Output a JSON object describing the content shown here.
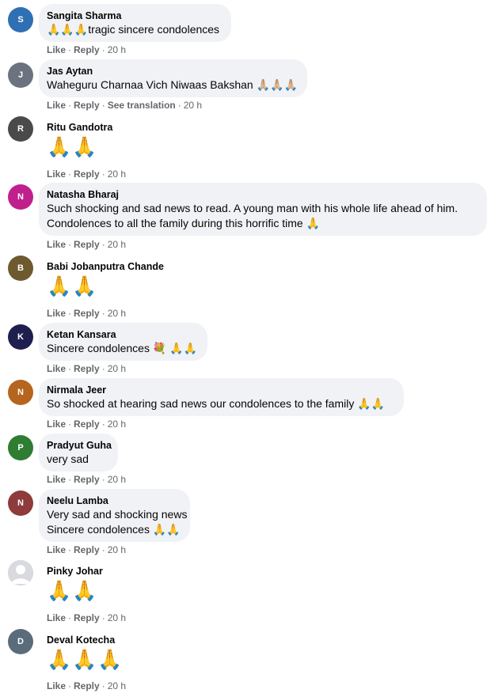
{
  "actions": {
    "like": "Like",
    "reply": "Reply",
    "see_translation": "See translation",
    "separator": "·"
  },
  "comments": [
    {
      "author": "Sangita Sharma",
      "text": "🙏🙏🙏tragic sincere condolences",
      "time": "20 h",
      "avatar_color": "#2f6fb3",
      "avatar_label": "S"
    },
    {
      "author": "Jas Aytan",
      "text": "Waheguru Charnaa Vich Niwaas Bakshan 🙏🏼🙏🏼🙏🏼",
      "time": "20 h",
      "avatar_color": "#6b7380",
      "avatar_label": "J"
    },
    {
      "author": "Ritu Gandotra",
      "text": "🙏🙏",
      "time": "20 h",
      "avatar_color": "#4a4a4a",
      "avatar_label": "R"
    },
    {
      "author": "Natasha Bharaj",
      "line1": "Such shocking and sad news to read. A young man with his whole life ahead of him.",
      "line2": "Condolences to all the family during this horrific time 🙏",
      "time": "20 h",
      "avatar_color": "#c0208c",
      "avatar_label": "N"
    },
    {
      "author": "Babi Jobanputra Chande",
      "text": "🙏🙏",
      "time": "20 h",
      "avatar_color": "#6e5a2e",
      "avatar_label": "B"
    },
    {
      "author": "Ketan Kansara",
      "text": "Sincere condolences 💐 🙏🙏",
      "time": "20 h",
      "avatar_color": "#1f1f4f",
      "avatar_label": "K"
    },
    {
      "author": "Nirmala Jeer",
      "text": "So shocked at hearing sad news our condolences to the family 🙏🙏",
      "time": "20 h",
      "avatar_color": "#b5651d",
      "avatar_label": "N"
    },
    {
      "author": "Pradyut Guha",
      "text": "very sad",
      "time": "20 h",
      "avatar_color": "#2e7d32",
      "avatar_label": "P"
    },
    {
      "author": "Neelu Lamba",
      "line1": "Very sad and shocking news",
      "line2": "Sincere condolences 🙏🙏",
      "time": "20 h",
      "avatar_color": "#8e3b3b",
      "avatar_label": "N"
    },
    {
      "author": "Pinky Johar",
      "text": "🙏🙏",
      "time": "20 h",
      "avatar_color": "#bcc0c4",
      "avatar_label": ""
    },
    {
      "author": "Deval Kotecha",
      "text": "🙏🙏🙏",
      "time": "20 h",
      "avatar_color": "#5a6b7a",
      "avatar_label": "D"
    }
  ]
}
